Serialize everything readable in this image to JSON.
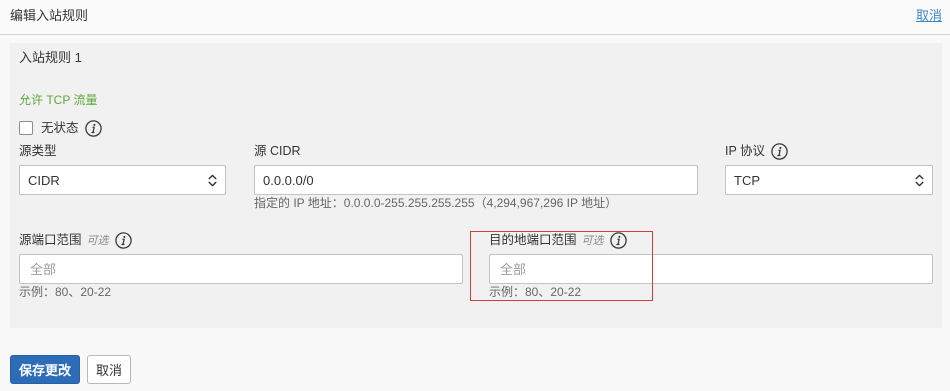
{
  "header": {
    "title": "编辑入站规则",
    "cancel_link": "取消"
  },
  "rule": {
    "title": "入站规则 1",
    "description": "允许 TCP 流量",
    "stateless": {
      "label": "无状态",
      "checked": false,
      "icon": "info-icon"
    },
    "source_type": {
      "label": "源类型",
      "value": "CIDR",
      "select_icon": "chevron-up-down-icon"
    },
    "source_cidr": {
      "label": "源 CIDR",
      "value": "0.0.0.0/0",
      "help": "指定的 IP 地址：0.0.0.0-255.255.255.255（4,294,967,296 IP 地址）"
    },
    "ip_protocol": {
      "label": "IP 协议",
      "value": "TCP",
      "icon": "info-icon",
      "select_icon": "chevron-up-down-icon"
    },
    "source_port_range": {
      "label": "源端口范围",
      "optional": "可选",
      "placeholder": "全部",
      "help": "示例：80、20-22",
      "icon": "info-icon"
    },
    "destination_port_range": {
      "label": "目的地端口范围",
      "optional": "可选",
      "placeholder": "全部",
      "help": "示例：80、20-22",
      "icon": "info-icon"
    }
  },
  "actions": {
    "save_label": "保存更改",
    "cancel_label": "取消"
  },
  "colors": {
    "accent": "#2d6cb6",
    "link": "#3f86c8",
    "success": "#5fa83a",
    "highlight": "#d23f3a"
  }
}
